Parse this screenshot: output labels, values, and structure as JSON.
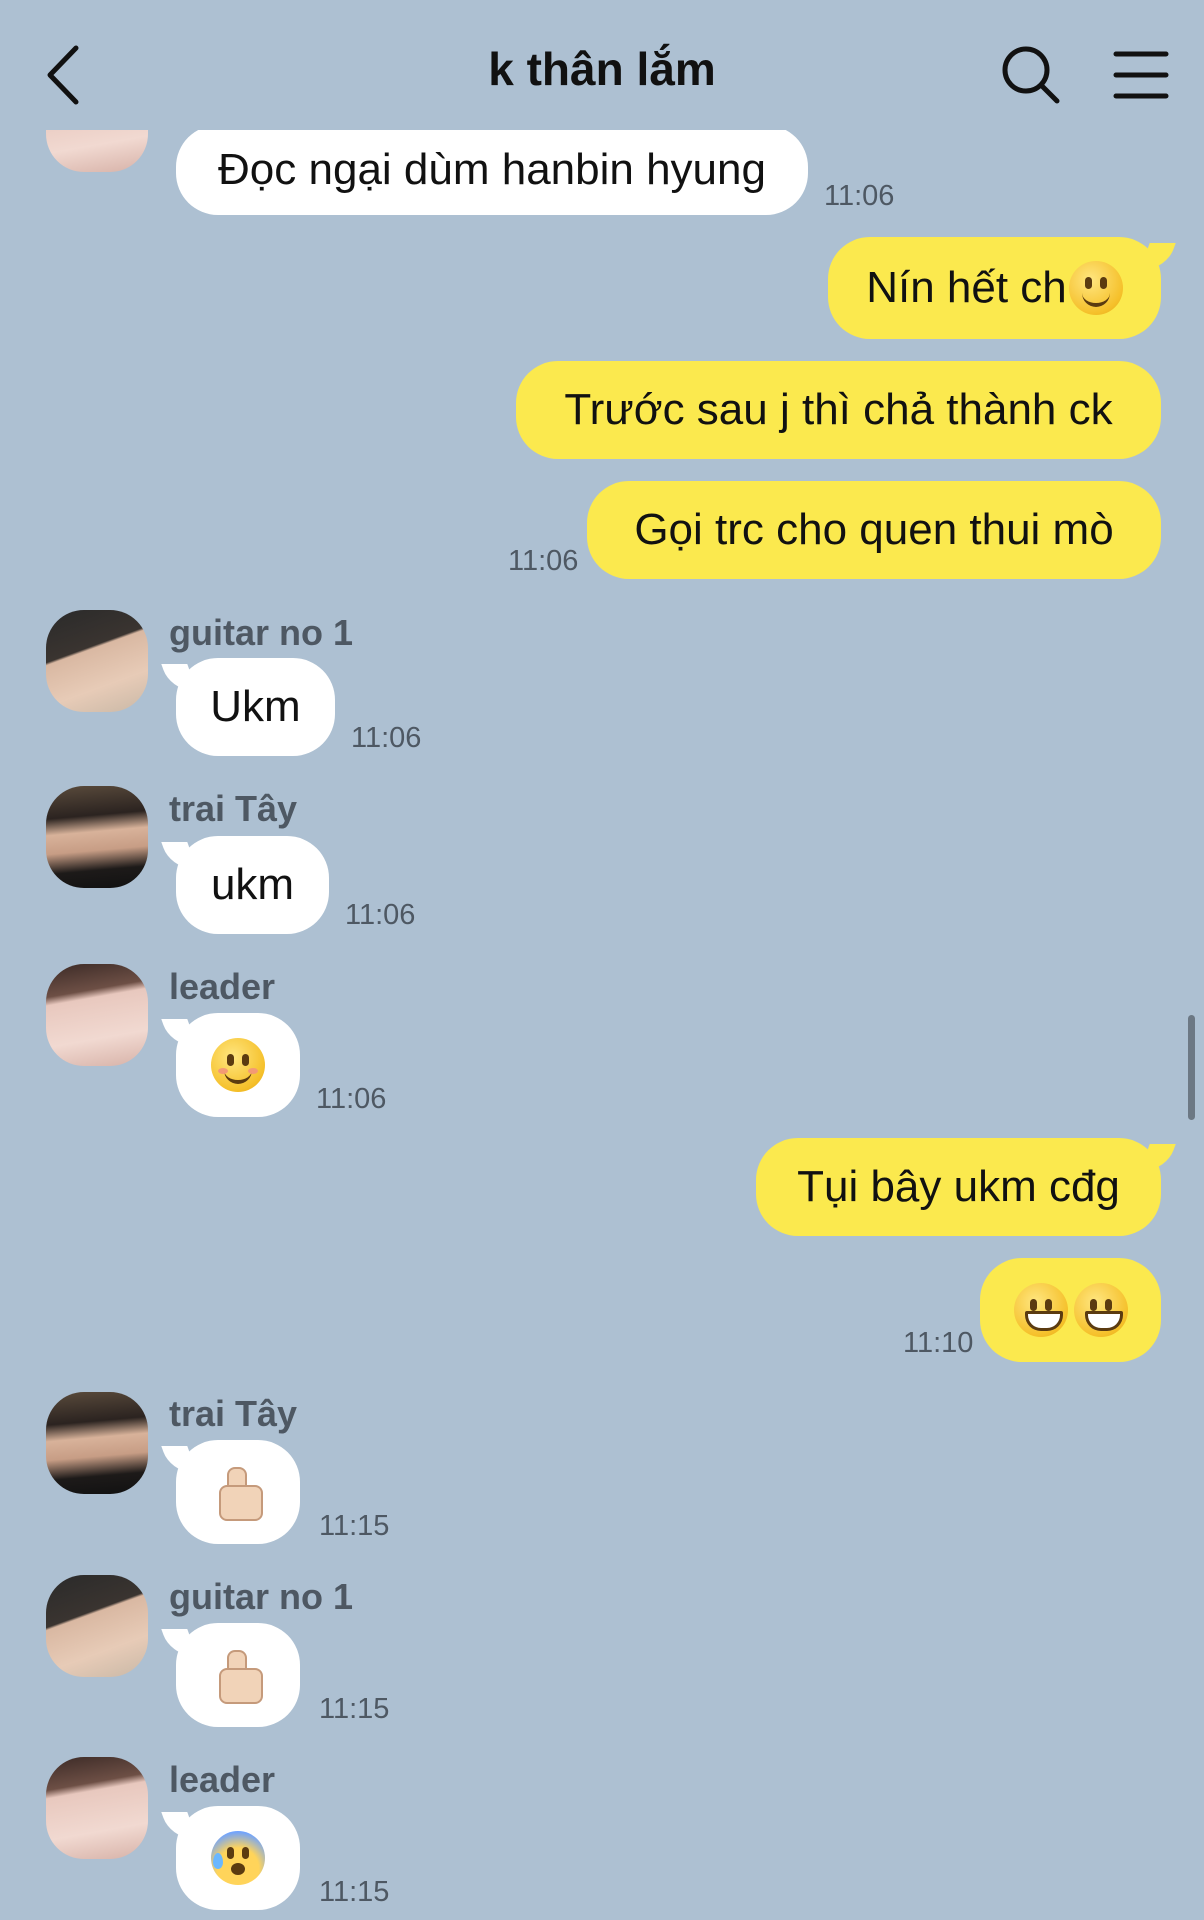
{
  "header": {
    "title": "k thân lắm",
    "back_icon": "chevron-left-icon",
    "search_icon": "search-icon",
    "menu_icon": "hamburger-menu-icon"
  },
  "colors": {
    "background": "#adc0d2",
    "bubble_outgoing": "#fbe94e",
    "bubble_incoming": "#ffffff"
  },
  "messages": [
    {
      "direction": "in",
      "text": "Đọc ngại dùm hanbin hyung",
      "time": "11:06"
    },
    {
      "direction": "out",
      "text": "Nín hết ch",
      "emoji": "slightly-smiling-face"
    },
    {
      "direction": "out",
      "text": "Trước sau j thì chả thành ck"
    },
    {
      "direction": "out",
      "text": "Gọi trc cho quen thui mò",
      "time": "11:06"
    },
    {
      "direction": "in",
      "sender": "guitar no 1",
      "text": "Ukm",
      "time": "11:06"
    },
    {
      "direction": "in",
      "sender": "trai Tây",
      "text": "ukm",
      "time": "11:06"
    },
    {
      "direction": "in",
      "sender": "leader",
      "emoji": "smiling-face-with-blush",
      "time": "11:06"
    },
    {
      "direction": "out",
      "text": "Tụi bây ukm cđg"
    },
    {
      "direction": "out",
      "emoji": "grinning-face x2",
      "time": "11:10"
    },
    {
      "direction": "in",
      "sender": "trai Tây",
      "emoji": "thumbs-up",
      "time": "11:15"
    },
    {
      "direction": "in",
      "sender": "guitar no 1",
      "emoji": "thumbs-up",
      "time": "11:15"
    },
    {
      "direction": "in",
      "sender": "leader",
      "emoji": "anxious-face-with-sweat",
      "time": "11:15"
    }
  ]
}
